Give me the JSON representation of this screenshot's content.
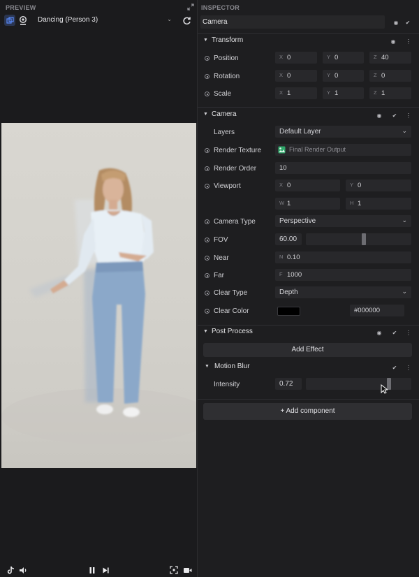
{
  "preview": {
    "title": "PREVIEW",
    "source": "Dancing (Person 3)"
  },
  "inspector": {
    "title": "INSPECTOR",
    "object_name": "Camera",
    "transform": {
      "title": "Transform",
      "position": {
        "label": "Position",
        "x": "0",
        "y": "0",
        "z": "40"
      },
      "rotation": {
        "label": "Rotation",
        "x": "0",
        "y": "0",
        "z": "0"
      },
      "scale": {
        "label": "Scale",
        "x": "1",
        "y": "1",
        "z": "1"
      }
    },
    "camera": {
      "title": "Camera",
      "layers": {
        "label": "Layers",
        "value": "Default Layer"
      },
      "render_texture": {
        "label": "Render Texture",
        "value": "Final Render Output"
      },
      "render_order": {
        "label": "Render Order",
        "value": "10"
      },
      "viewport": {
        "label": "Viewport",
        "x": "0",
        "y": "0",
        "w": "1",
        "h": "1"
      },
      "camera_type": {
        "label": "Camera Type",
        "value": "Perspective"
      },
      "fov": {
        "label": "FOV",
        "value": "60.00",
        "slider_fraction": 0.55
      },
      "near": {
        "label": "Near",
        "axis": "N",
        "value": "0.10"
      },
      "far": {
        "label": "Far",
        "axis": "F",
        "value": "1000"
      },
      "clear_type": {
        "label": "Clear Type",
        "value": "Depth"
      },
      "clear_color": {
        "label": "Clear Color",
        "hex": "#000000",
        "swatch": "#000000"
      }
    },
    "post_process": {
      "title": "Post Process",
      "add_effect": "Add Effect",
      "motion_blur": {
        "title": "Motion Blur",
        "intensity": {
          "label": "Intensity",
          "value": "0.72",
          "slider_fraction": 0.72
        }
      }
    },
    "add_component": "+ Add component"
  },
  "axis_labels": {
    "x": "X",
    "y": "Y",
    "z": "Z",
    "w": "W",
    "h": "H"
  },
  "colors": {
    "accent": "#3b82f6",
    "panel": "#1e1e20",
    "field": "#28282b"
  }
}
